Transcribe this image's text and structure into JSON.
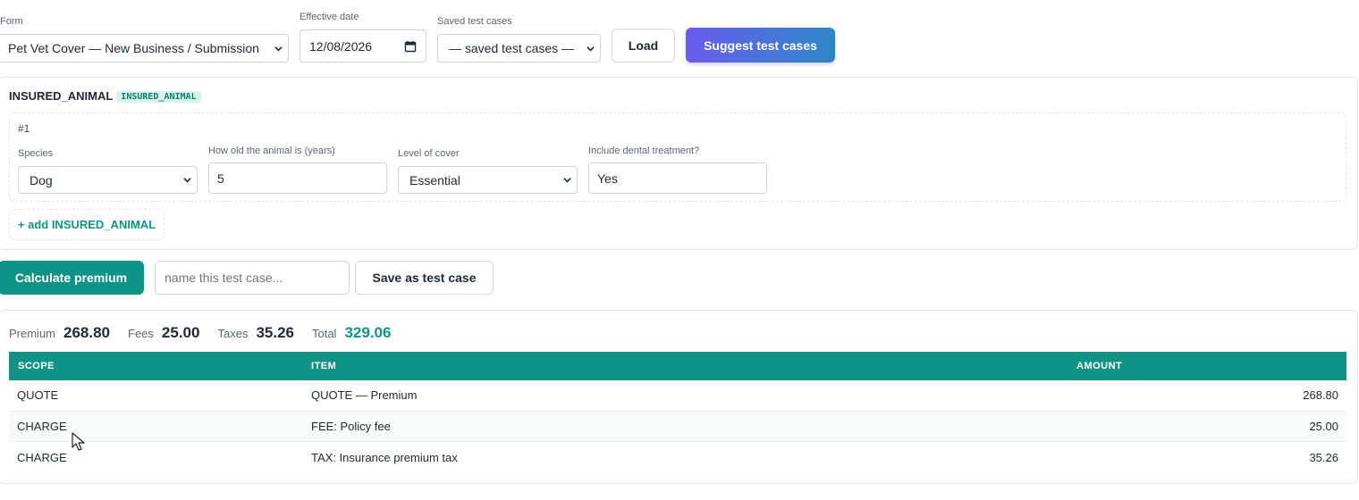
{
  "header": {
    "form_label": "Form",
    "form_value": "Pet Vet Cover — New Business / Submission",
    "effective_date_label": "Effective date",
    "effective_date_value": "12/08/2026",
    "saved_label": "Saved test cases",
    "saved_value": "— saved test cases —",
    "load_label": "Load",
    "suggest_label": "Suggest test cases"
  },
  "section": {
    "title": "INSURED_ANIMAL",
    "tag": "INSURED_ANIMAL",
    "item_index": "#1",
    "fields": [
      {
        "label": "Species",
        "value": "Dog"
      },
      {
        "label": "How old the animal is (years)",
        "value": "5"
      },
      {
        "label": "Level of cover",
        "value": "Essential"
      },
      {
        "label": "Include dental treatment?",
        "value": "Yes"
      }
    ],
    "add_label": "+ add INSURED_ANIMAL"
  },
  "actions": {
    "calculate_label": "Calculate premium",
    "name_placeholder": "name this test case...",
    "save_label": "Save as test case"
  },
  "summary": {
    "premium_label": "Premium",
    "premium_value": "268.80",
    "fees_label": "Fees",
    "fees_value": "25.00",
    "taxes_label": "Taxes",
    "taxes_value": "35.26",
    "total_label": "Total",
    "total_value": "329.06"
  },
  "table": {
    "headers": [
      "SCOPE",
      "ITEM",
      "AMOUNT"
    ],
    "rows": [
      {
        "scope": "QUOTE",
        "item": "QUOTE — Premium",
        "amount": "268.80"
      },
      {
        "scope": "CHARGE",
        "item": "FEE: Policy fee",
        "amount": "25.00"
      },
      {
        "scope": "CHARGE",
        "item": "TAX: Insurance premium tax",
        "amount": "35.26"
      }
    ]
  },
  "colors": {
    "teal": "#0e9384",
    "suggest_gradient_start": "#6a5cf0",
    "suggest_gradient_end": "#2d86c6"
  }
}
